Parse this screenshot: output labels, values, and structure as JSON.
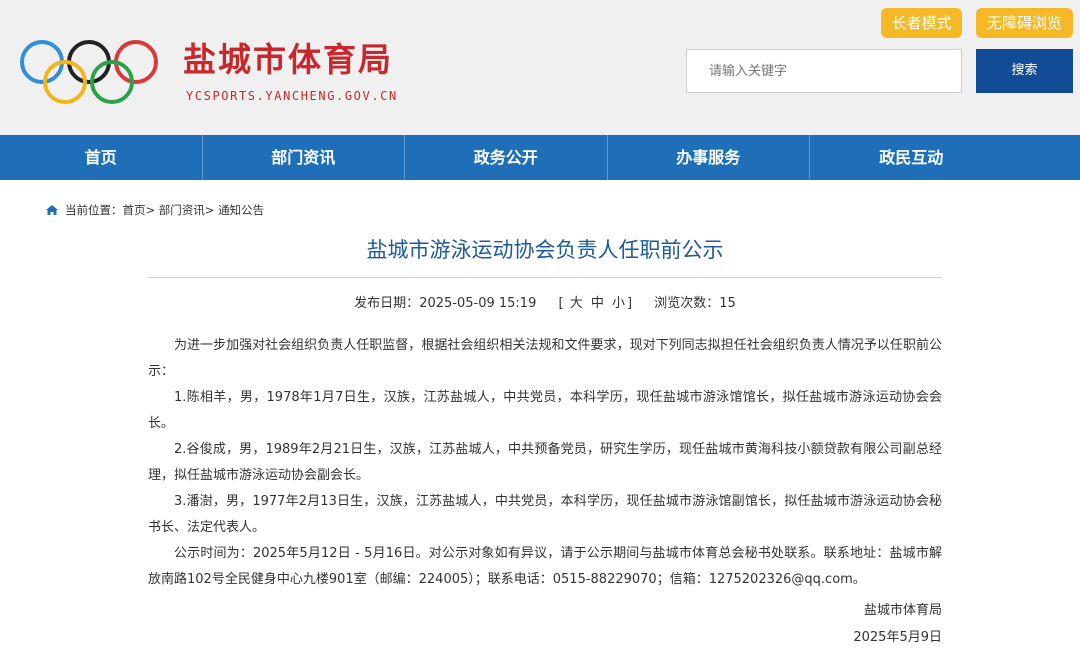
{
  "header": {
    "site_title": "盐城市体育局",
    "site_subtitle": "YCSPORTS.YANCHENG.GOV.CN",
    "elder_mode": "长者模式",
    "accessibility": "无障碍浏览",
    "search_placeholder": "请输入关键字",
    "search_button": "搜索",
    "colors": {
      "title": "#c8282d",
      "accent": "#f5b928",
      "button": "#124b96"
    }
  },
  "nav": {
    "items": [
      {
        "label": "首页"
      },
      {
        "label": "部门资讯"
      },
      {
        "label": "政务公开"
      },
      {
        "label": "办事服务"
      },
      {
        "label": "政民互动"
      }
    ],
    "color": "#1e6fb8"
  },
  "breadcrumb": {
    "icon": "home-icon",
    "prefix": "当前位置：",
    "items": [
      "首页",
      "部门资讯",
      "通知公告"
    ],
    "separator": ">"
  },
  "article": {
    "title": "盐城市游泳运动协会负责人任职前公示",
    "publish_label": "发布日期：",
    "publish_date": "2025-05-09 15:19",
    "size_open": "[",
    "size_large": "大",
    "size_medium": "中",
    "size_small": "小",
    "size_close": "]",
    "views_label": "浏览次数：",
    "views": "15",
    "paragraphs": [
      "为进一步加强对社会组织负责人任职监督，根据社会组织相关法规和文件要求，现对下列同志拟担任社会组织负责人情况予以任职前公示：",
      "1.陈相羊，男，1978年1月7日生，汉族，江苏盐城人，中共党员，本科学历，现任盐城市游泳馆馆长，拟任盐城市游泳运动协会会长。",
      "2.谷俊成，男，1989年2月21日生，汉族，江苏盐城人，中共预备党员，研究生学历，现任盐城市黄海科技小额贷款有限公司副总经理，拟任盐城市游泳运动协会副会长。",
      "3.潘澍，男，1977年2月13日生，汉族，江苏盐城人，中共党员，本科学历，现任盐城市游泳馆副馆长，拟任盐城市游泳运动协会秘书长、法定代表人。",
      "公示时间为：2025年5月12日 - 5月16日。对公示对象如有异议，请于公示期间与盐城市体育总会秘书处联系。联系地址：盐城市解放南路102号全民健身中心九楼901室（邮编：224005）；联系电话：0515-88229070；信箱：1275202326@qq.com。"
    ],
    "signature_org": "盐城市体育局",
    "signature_date": "2025年5月9日"
  }
}
